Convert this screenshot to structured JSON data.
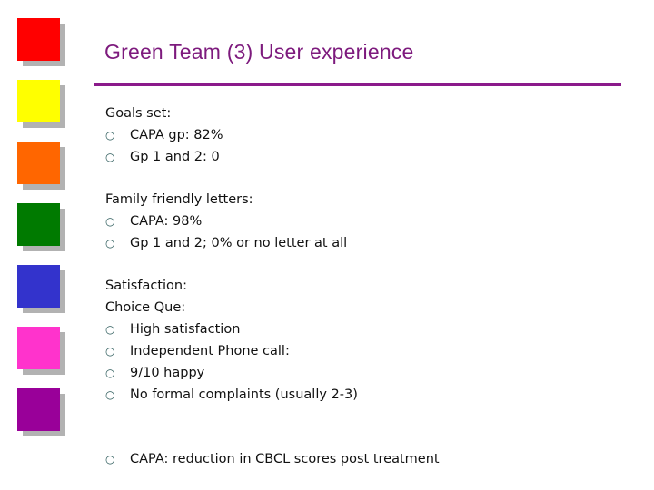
{
  "slide": {
    "title": "Green Team (3) User experience",
    "accent_color": "#8b1a8b",
    "decor_squares": [
      {
        "name": "red",
        "color": "#ff0000"
      },
      {
        "name": "yellow",
        "color": "#ffff00"
      },
      {
        "name": "orange",
        "color": "#ff6600"
      },
      {
        "name": "green",
        "color": "#007a00"
      },
      {
        "name": "blue",
        "color": "#3333cc"
      },
      {
        "name": "pink",
        "color": "#ff33cc"
      },
      {
        "name": "purple",
        "color": "#990099"
      }
    ],
    "bullet_glyph": "○",
    "sections": {
      "goals": {
        "heading": "Goals set:",
        "items": [
          "CAPA gp: 82%",
          "Gp 1 and 2: 0"
        ]
      },
      "letters": {
        "heading": "Family friendly letters:",
        "items": [
          "CAPA: 98%",
          "Gp 1 and 2; 0% or no letter at all"
        ]
      },
      "satisfaction": {
        "heading": "Satisfaction:",
        "subheading": "Choice Que:",
        "items": [
          "High satisfaction",
          "Independent Phone call:",
          "9/10 happy",
          "No formal complaints (usually 2-3)"
        ]
      },
      "outcome": {
        "items": [
          "CAPA: reduction in CBCL scores post treatment"
        ]
      }
    }
  }
}
